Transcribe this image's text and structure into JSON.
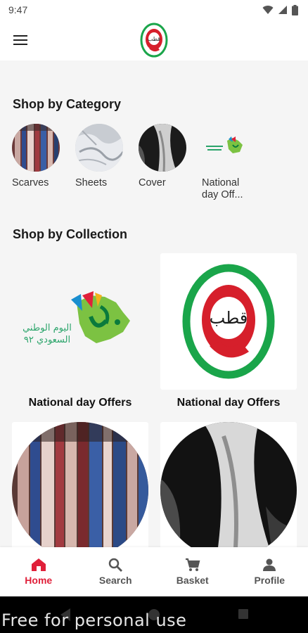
{
  "status": {
    "time": "9:47"
  },
  "header": {
    "menu_icon": "menu-icon",
    "logo_text": "قطب"
  },
  "categories": {
    "title": "Shop by Category",
    "items": [
      {
        "label": "Scarves"
      },
      {
        "label": "Sheets"
      },
      {
        "label": "Cover"
      },
      {
        "label": "National day Off..."
      }
    ]
  },
  "collections": {
    "title": "Shop by Collection",
    "items": [
      {
        "label": "National day Offers"
      },
      {
        "label": "National day Offers"
      }
    ]
  },
  "national_logo": {
    "line1": "اليوم الوطني",
    "line2": "السعودي ٩٢"
  },
  "bottom_nav": {
    "items": [
      {
        "label": "Home",
        "icon": "home-icon",
        "active": true
      },
      {
        "label": "Search",
        "icon": "search-icon",
        "active": false
      },
      {
        "label": "Basket",
        "icon": "cart-icon",
        "active": false
      },
      {
        "label": "Profile",
        "icon": "person-icon",
        "active": false
      }
    ]
  },
  "watermark": "Free for personal use",
  "colors": {
    "accent": "#e0203a",
    "brand_green": "#1aa54a",
    "brand_red": "#d61f2b"
  }
}
